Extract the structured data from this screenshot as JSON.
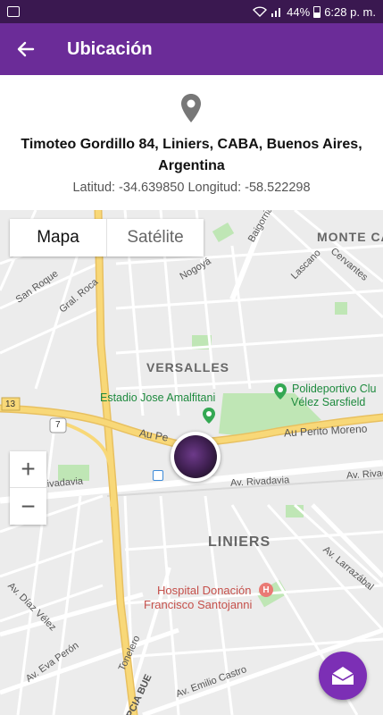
{
  "status_bar": {
    "battery": "44%",
    "time": "6:28 p. m."
  },
  "app_bar": {
    "title": "Ubicación"
  },
  "location": {
    "address": "Timoteo Gordillo 84, Liniers, CABA, Buenos Aires, Argentina",
    "coordinates": "Latitud: -34.639850 Longitud: -58.522298"
  },
  "map": {
    "map_type_options": [
      "Mapa",
      "Satélite"
    ],
    "selected_map_type": "Mapa",
    "zoom_in_label": "+",
    "zoom_out_label": "−",
    "neighborhoods": [
      "MONTE CA",
      "VERSALLES",
      "LINIERS"
    ],
    "places": {
      "stadium": "Estadio Jose Amalfitani",
      "sports_center_line1": "Polideportivo Clu",
      "sports_center_line2": "Vélez Sarsfield",
      "hospital_line1": "Hospital Donación",
      "hospital_line2": "Francisco Santojanni"
    },
    "streets": {
      "san_roque": "San Roque",
      "gral_roca": "Gral. Roca",
      "nogoya": "Nogoyá",
      "baigorria": "Baigorria",
      "lascano": "Lascano",
      "cervantes": "Cervantes",
      "au_pe": "Au Pe",
      "au_perito_moreno": "Au Perito Moreno",
      "av_rivadavia_left": "v. Rivadavia",
      "av_rivadavia_mid": "Av. Rivadavia",
      "av_rivadavia_right": "Av. Rivad",
      "av_diaz_velez": "Av. Díaz Vélez",
      "av_eva_peron": "Av. Eva Perón",
      "tonelero": "Tonelero",
      "av_emilio_castro": "Av. Emilio Castro",
      "av_larrazabal": "Av. Larrazábal",
      "pcia_bue": "PCIA BUE"
    },
    "route_shields": [
      "13",
      "7"
    ],
    "hospital_badge": "H"
  },
  "colors": {
    "app_bar": "#6b2c98",
    "status_bar": "#3a1850",
    "fab": "#7c2fb5",
    "highway": "#f8d878",
    "park": "#bfe6b5"
  }
}
